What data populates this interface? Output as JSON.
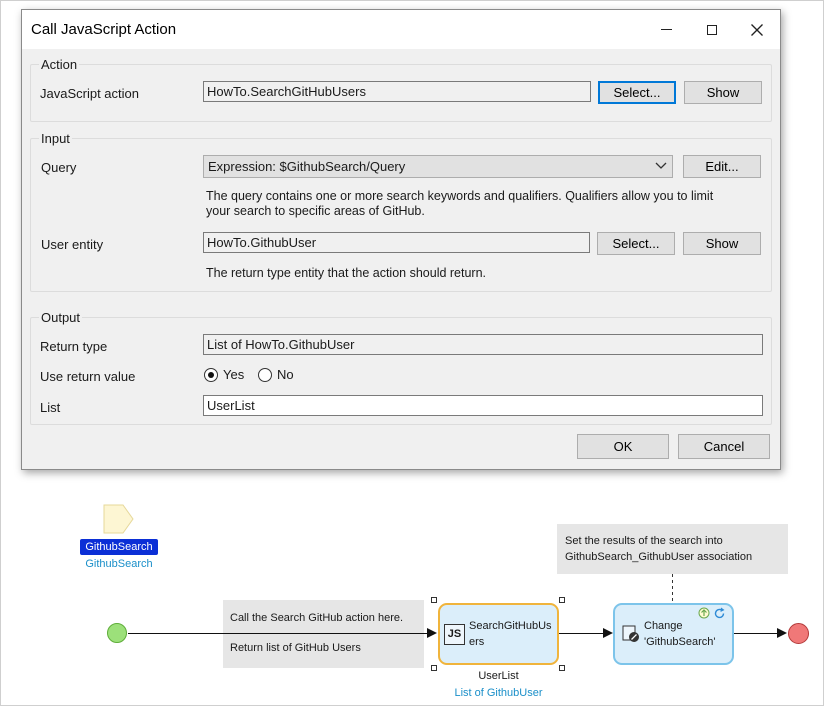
{
  "dialog": {
    "title": "Call JavaScript Action",
    "action_group": {
      "label": "Action",
      "js_action_label": "JavaScript action",
      "js_action_value": "HowTo.SearchGitHubUsers",
      "select_label": "Select...",
      "show_label": "Show"
    },
    "input_group": {
      "label": "Input",
      "query_label": "Query",
      "query_value": "Expression: $GithubSearch/Query",
      "edit_label": "Edit...",
      "query_help_line1": "The query contains one or more search keywords and qualifiers. Qualifiers allow you to limit",
      "query_help_line2": "your search to specific areas of GitHub.",
      "user_entity_label": "User entity",
      "user_entity_value": "HowTo.GithubUser",
      "select_label": "Select...",
      "show_label": "Show",
      "user_entity_help": "The return type entity that the action should return."
    },
    "output_group": {
      "label": "Output",
      "return_type_label": "Return type",
      "return_type_value": "List of HowTo.GithubUser",
      "use_return_label": "Use return value",
      "yes_label": "Yes",
      "no_label": "No",
      "selected": "Yes",
      "list_label": "List",
      "list_value": "UserList"
    },
    "ok_label": "OK",
    "cancel_label": "Cancel"
  },
  "canvas": {
    "parameter": {
      "badge": "GithubSearch",
      "type": "GithubSearch",
      "color": "#0b2fd6"
    },
    "note_top_line1": "Set the results of the search into",
    "note_top_line2": "GithubSearch_GithubUser association",
    "note_left_line1": "Call the Search GitHub action here.",
    "note_left_line2": "Return list of GitHub Users",
    "js_activity": {
      "line1": "SearchGitHubUs",
      "line2": "ers",
      "icon_text": "JS",
      "output_var": "UserList",
      "output_type": "List of GithubUser",
      "border_color": "#f0b43c",
      "fill_color": "#dbeefa"
    },
    "change_activity": {
      "line1": "Change",
      "line2": "'GithubSearch'",
      "border_color": "#7cc4ea",
      "fill_color": "#dbeefa"
    },
    "start_color": "#9ce07a",
    "end_color": "#f07878"
  }
}
